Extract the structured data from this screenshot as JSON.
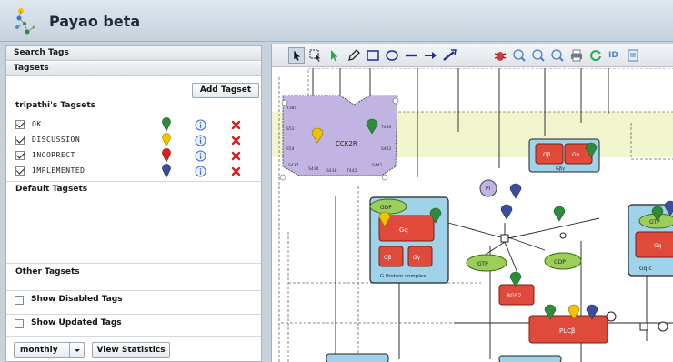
{
  "app": {
    "title": "Payao beta"
  },
  "panels": {
    "search_tags": "Search Tags",
    "tagsets": "Tagsets"
  },
  "tagsets": {
    "add_button": "Add Tagset",
    "my_title": "tripathi's Tagsets",
    "tags": [
      {
        "name": "OK",
        "checked": true,
        "pin_color": "#2e8b3a"
      },
      {
        "name": "DISCUSSION",
        "checked": true,
        "pin_color": "#f2c200"
      },
      {
        "name": "INCORRECT",
        "checked": true,
        "pin_color": "#d92020"
      },
      {
        "name": "IMPLEMENTED",
        "checked": true,
        "pin_color": "#3a4e9c"
      }
    ],
    "default_title": "Default Tagsets",
    "other_title": "Other Tagsets"
  },
  "options": {
    "show_disabled": "Show Disabled Tags",
    "show_updated": "Show Updated Tags",
    "period_select": "monthly",
    "view_stats": "View Statistics"
  },
  "toolbar": {
    "tools": [
      "pointer-icon",
      "select-region-icon",
      "green-arrow-icon",
      "pencil-icon",
      "rectangle-icon",
      "ellipse-icon",
      "line-icon",
      "arrow-icon",
      "connector-icon",
      "bug-icon",
      "zoom-in-icon",
      "zoom-out-icon",
      "zoom-fit-icon",
      "print-icon",
      "refresh-icon"
    ],
    "id_label": "ID"
  },
  "diagram": {
    "receptor_label": "CCK2R",
    "receptor_sites": [
      "Y380",
      "S52",
      "S54",
      "S437",
      "S434",
      "S438",
      "T442",
      "S441",
      "T446",
      "S442"
    ],
    "gby_label": "Gβγ",
    "gb_label": "Gβ",
    "gy_label": "Gγ",
    "gdp_label": "GDP",
    "gq_label": "Gq",
    "gq_sub": "q",
    "complex_label": "G Protein complex",
    "pi_label": "Pi",
    "gtp_label": "GTP",
    "gtp_right_label": "GTP",
    "gdp_right_label": "GDP",
    "rgs_label": "RGS2",
    "plcb_label": "PLCβ",
    "gq_complex_label": "Gq c",
    "colors": {
      "node_fill": "#e04a3a",
      "complex_fill": "#9fd3ea",
      "green_node": "#9ccf5a",
      "receptor_fill": "#c2b4e2"
    }
  }
}
